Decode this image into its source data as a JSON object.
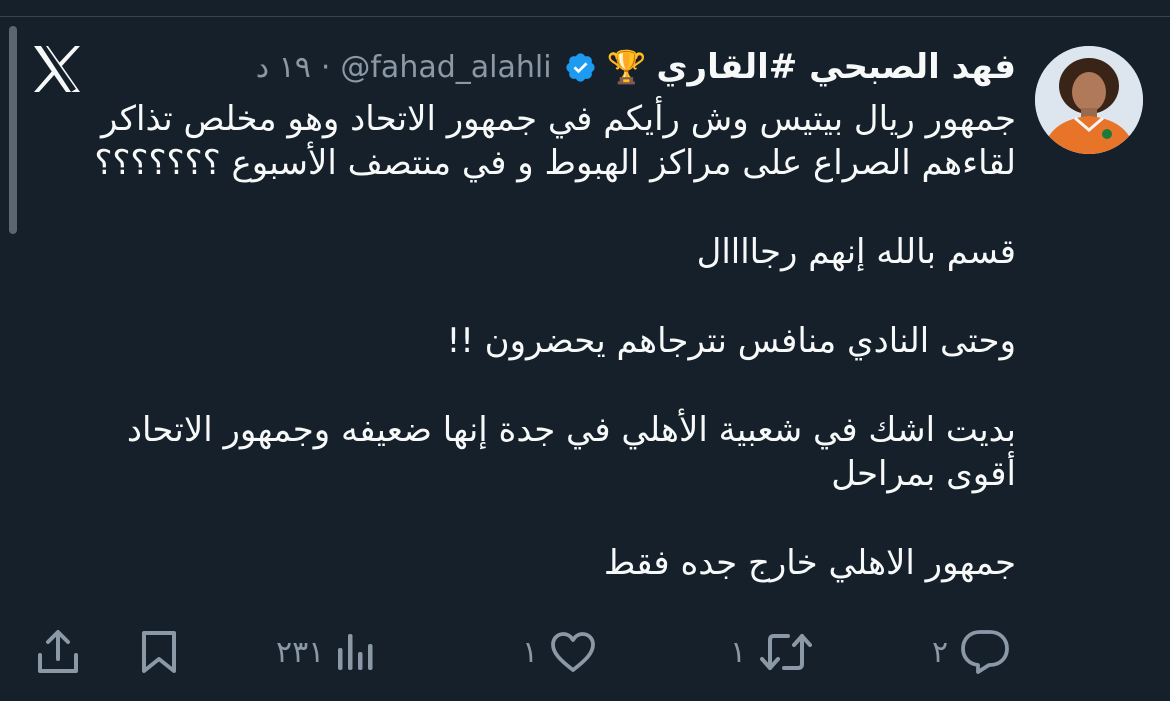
{
  "tweet": {
    "display_name": "فهد الصبحي #القاري",
    "badge_emoji": "🏆",
    "handle": "@fahad_alahli",
    "separator": "·",
    "time": "١٩ د",
    "paragraphs": [
      "جمهور ريال بيتيس وش رأيكم في جمهور الاتحاد وهو مخلص تذاكر لقاءهم الصراع على مراكز الهبوط و في منتصف الأسبوع ؟؟؟؟؟؟؟",
      "قسم بالله إنهم رجاااال",
      "وحتى النادي منافس نترجاهم يحضرون !!",
      "بديت اشك في شعبية الأهلي في جدة إنها ضعيفه وجمهور الاتحاد أقوى بمراحل",
      "جمهور الاهلي خارج جده فقط"
    ]
  },
  "actions": {
    "reply_count": "٢",
    "retweet_count": "١",
    "like_count": "١",
    "views_count": "٢٣١"
  },
  "icons": {
    "app_logo": "x-logo-icon",
    "verified": "verified-badge-icon",
    "reply": "reply-icon",
    "retweet": "retweet-icon",
    "like": "heart-icon",
    "views": "bar-chart-icon",
    "bookmark": "bookmark-icon",
    "share": "share-icon"
  },
  "colors": {
    "background": "#15202b",
    "text": "#f7f9f9",
    "muted": "#8b98a5",
    "verified": "#1d9bf0"
  }
}
